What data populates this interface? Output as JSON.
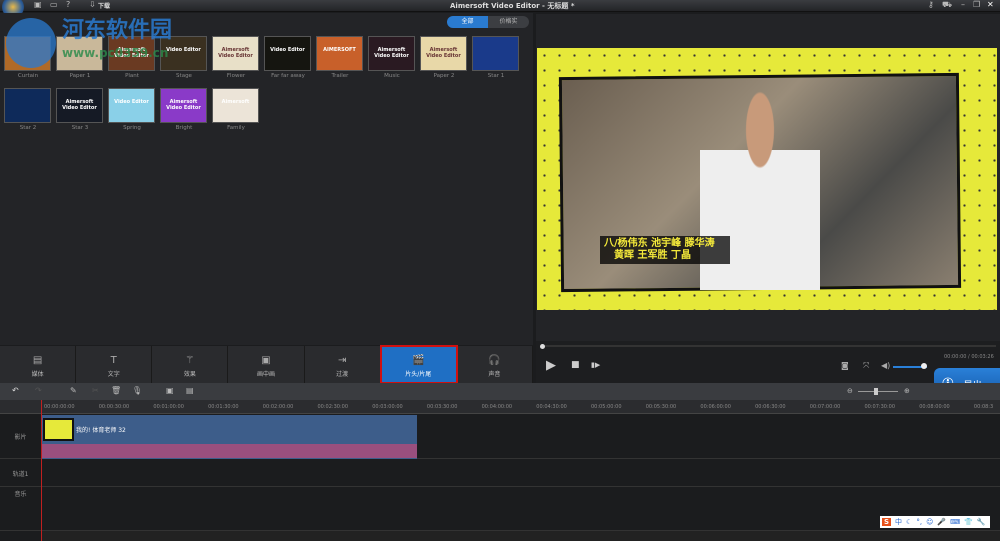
{
  "titlebar": {
    "title": "Aimersoft Video Editor - 无标题 *",
    "download": "下载",
    "icons": [
      "save-icon",
      "comment-icon",
      "help-icon",
      "key-icon",
      "cart-icon",
      "minimize-icon",
      "restore-icon",
      "close-icon"
    ]
  },
  "watermark": {
    "name": "河东软件园",
    "url": "www.pc0359.cn"
  },
  "filter_tabs": [
    "全部",
    "价格实"
  ],
  "templates": [
    {
      "label": "Curtain",
      "color": "#b06a28",
      "text": ""
    },
    {
      "label": "Paper 1",
      "color": "#c9b89a",
      "text": ""
    },
    {
      "label": "Plant",
      "color": "#6a3a22",
      "text": "Aimersoft Video Editor"
    },
    {
      "label": "Stage",
      "color": "#3a3020",
      "text": "Video Editor"
    },
    {
      "label": "Flower",
      "color": "#e8e0c8",
      "text": "Aimersoft Video Editor"
    },
    {
      "label": "Far far away",
      "color": "#151510",
      "text": "Video Editor"
    },
    {
      "label": "Trailer",
      "color": "#c8602a",
      "text": "AIMERSOFT"
    },
    {
      "label": "Music",
      "color": "#2a1a22",
      "text": "Aimersoft Video Editor"
    },
    {
      "label": "Paper 2",
      "color": "#e8d8a8",
      "text": "Aimersoft Video Editor"
    },
    {
      "label": "Star 1",
      "color": "#1a3a8a",
      "text": ""
    },
    {
      "label": "Star 2",
      "color": "#0e2a5a",
      "text": ""
    },
    {
      "label": "Star 3",
      "color": "#151a25",
      "text": "Aimersoft Video Editor"
    },
    {
      "label": "Spring",
      "color": "#8ad0e8",
      "text": "Video Editor"
    },
    {
      "label": "Bright",
      "color": "#8a3ac8",
      "text": "Aimersoft Video Editor"
    },
    {
      "label": "Family",
      "color": "#ece4d8",
      "text": "Aimersoft"
    }
  ],
  "preview": {
    "subtitle_line1": "八/杨伟东 池宇峰 滕华涛",
    "subtitle_line2": "黄晖 王军胜 丁晶",
    "time": "00:00:00 / 00:03:26",
    "volume": 0.85,
    "progress": 0
  },
  "bottom_tabs": [
    {
      "label": "媒体",
      "icon": "media-icon",
      "glyph": "▤"
    },
    {
      "label": "文字",
      "icon": "text-icon",
      "glyph": "T"
    },
    {
      "label": "效果",
      "icon": "magic-wand-icon",
      "glyph": "⚚"
    },
    {
      "label": "画中画",
      "icon": "pip-icon",
      "glyph": "▣"
    },
    {
      "label": "过渡",
      "icon": "transition-icon",
      "glyph": "⇥"
    },
    {
      "label": "片头/片尾",
      "icon": "clapper-icon",
      "glyph": "🎬",
      "active": true
    },
    {
      "label": "声音",
      "icon": "headphones-icon",
      "glyph": "🎧"
    }
  ],
  "export_label": "导出",
  "timeline": {
    "ticks": [
      "00:00:00:00",
      "00:00:30:00",
      "00:01:00:00",
      "00:01:30:00",
      "00:02:00:00",
      "00:02:30:00",
      "00:03:00:00",
      "00:03:30:00",
      "00:04:00:00",
      "00:04:30:00",
      "00:05:00:00",
      "00:05:30:00",
      "00:06:00:00",
      "00:06:30:00",
      "00:07:00:00",
      "00:07:30:00",
      "00:08:00:00",
      "00:08:3"
    ],
    "tracks": [
      "影片",
      "轨道1",
      "音乐"
    ],
    "clip_label": "我的! 体育老师 32"
  },
  "ime": {
    "logo": "S",
    "mode": "中"
  }
}
